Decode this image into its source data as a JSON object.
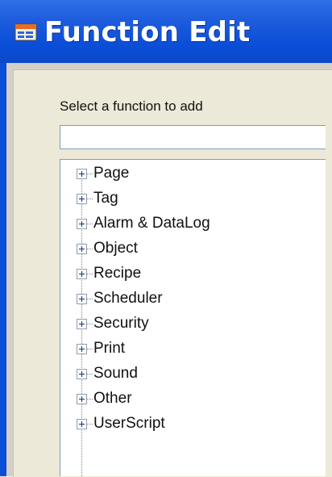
{
  "window": {
    "title": "Function Edit",
    "title_icon": "app-window-icon",
    "colors": {
      "titlebar": "#0b4ed8",
      "titlebar_text": "#ffffff",
      "dialog_background": "#ece9d8",
      "control_border": "#7f9db9"
    }
  },
  "dialog": {
    "prompt_label": "Select a function to add",
    "function_input": {
      "value": "",
      "placeholder": ""
    }
  },
  "tree": {
    "expander_icon": "plus-box-icon",
    "items": [
      {
        "label": "Page",
        "expanded": false
      },
      {
        "label": "Tag",
        "expanded": false
      },
      {
        "label": "Alarm & DataLog",
        "expanded": false
      },
      {
        "label": "Object",
        "expanded": false
      },
      {
        "label": "Recipe",
        "expanded": false
      },
      {
        "label": "Scheduler",
        "expanded": false
      },
      {
        "label": "Security",
        "expanded": false
      },
      {
        "label": "Print",
        "expanded": false
      },
      {
        "label": "Sound",
        "expanded": false
      },
      {
        "label": "Other",
        "expanded": false
      },
      {
        "label": "UserScript",
        "expanded": false
      }
    ]
  }
}
